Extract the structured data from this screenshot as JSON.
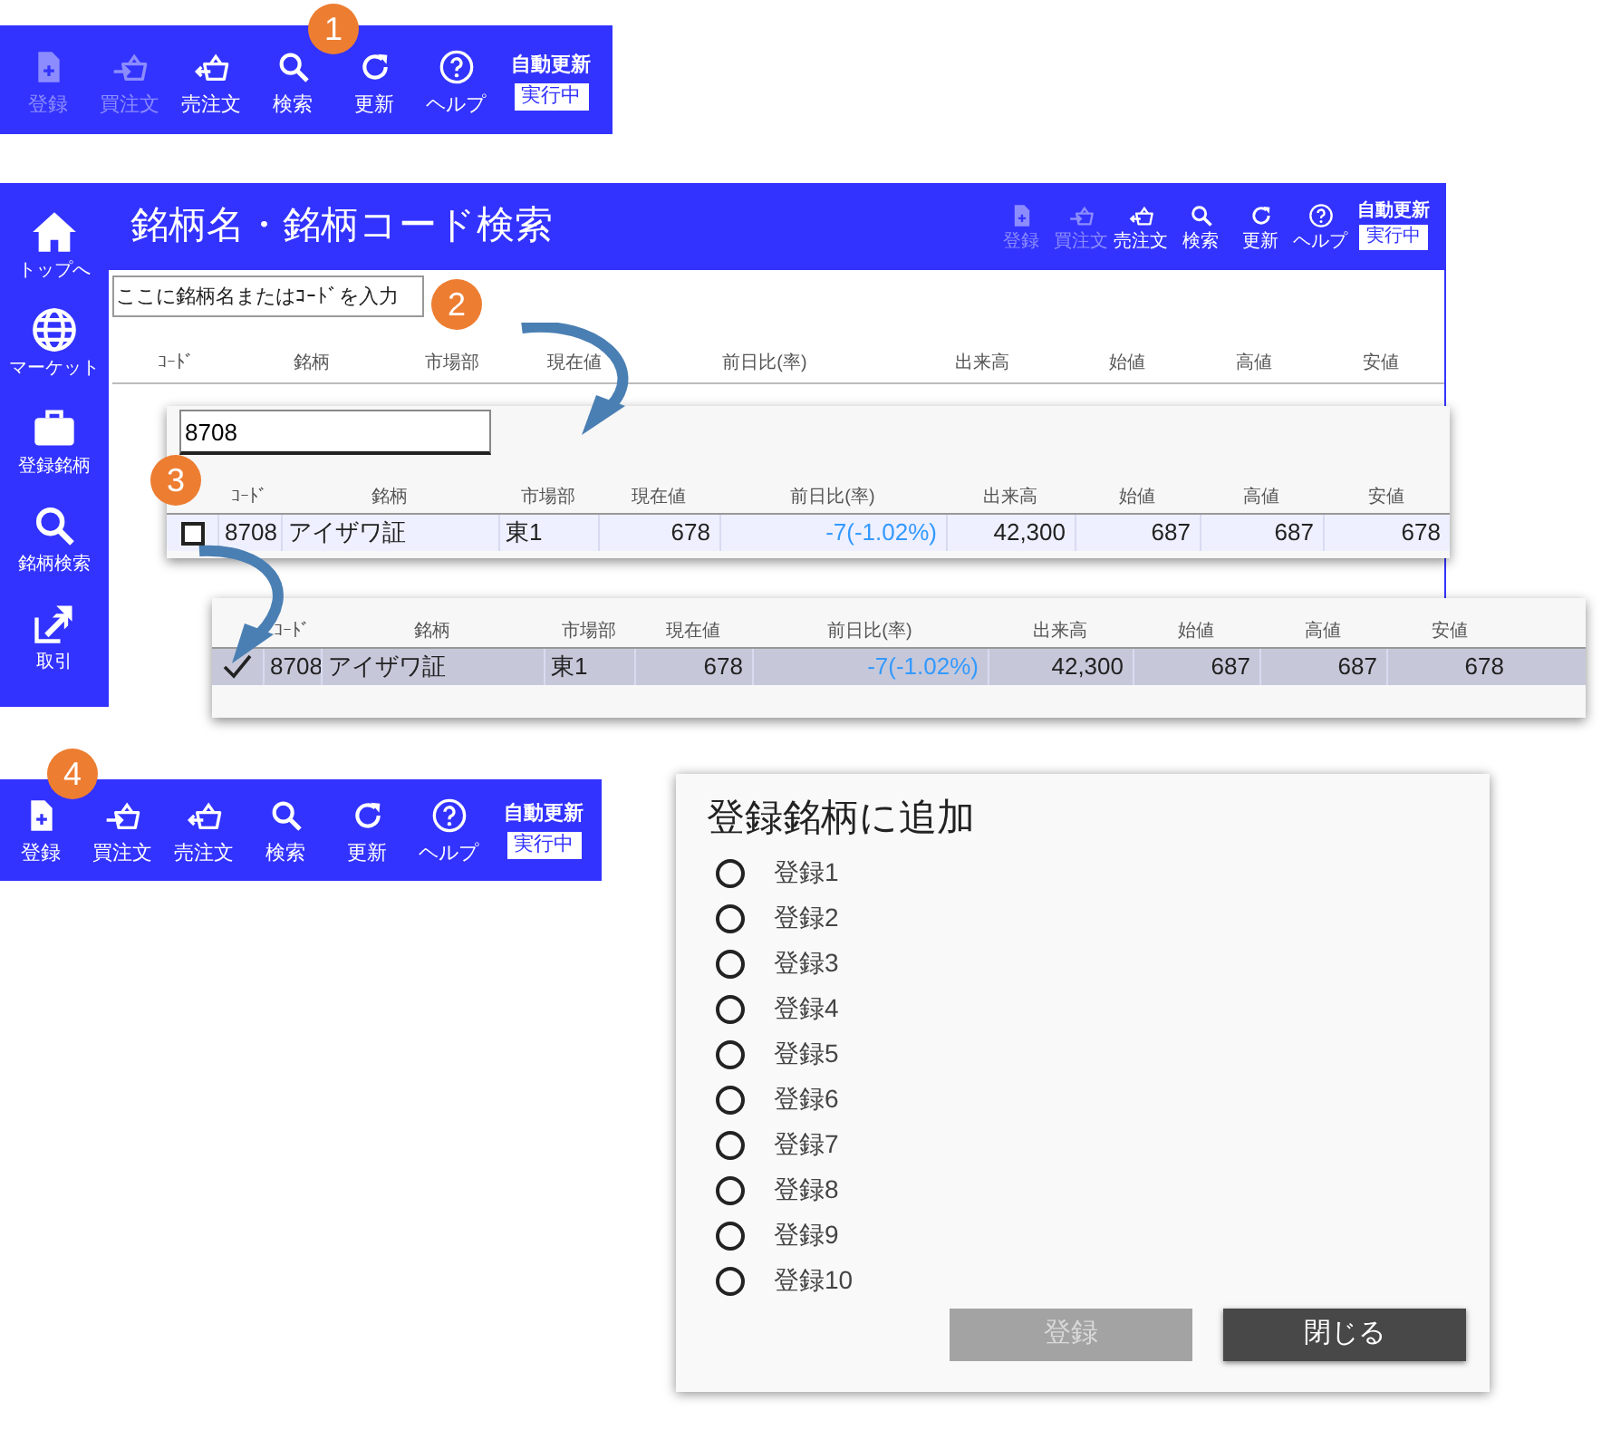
{
  "toolbar_1": {
    "step": "1",
    "buttons": [
      {
        "kind": "register",
        "label": "登録",
        "disabled": true
      },
      {
        "kind": "buy",
        "label": "買注文",
        "disabled": true
      },
      {
        "kind": "sell",
        "label": "売注文",
        "disabled": false
      },
      {
        "kind": "search",
        "label": "検索",
        "disabled": false
      },
      {
        "kind": "refresh",
        "label": "更新",
        "disabled": false
      },
      {
        "kind": "help",
        "label": "ヘルプ",
        "disabled": false
      }
    ],
    "auto_update": {
      "label": "自動更新",
      "status": "実行中"
    }
  },
  "search_window": {
    "title": "銘柄名・銘柄コード検索",
    "step": "2",
    "sidebar": [
      {
        "kind": "home",
        "label": "トップへ"
      },
      {
        "kind": "globe",
        "label": "マーケット"
      },
      {
        "kind": "briefcase",
        "label": "登録銘柄"
      },
      {
        "kind": "search",
        "label": "銘柄検索"
      },
      {
        "kind": "trade",
        "label": "取引"
      }
    ],
    "toolbar": {
      "buttons": [
        {
          "kind": "register",
          "label": "登録",
          "disabled": true
        },
        {
          "kind": "buy",
          "label": "買注文",
          "disabled": true
        },
        {
          "kind": "sell",
          "label": "売注文",
          "disabled": false
        },
        {
          "kind": "search",
          "label": "検索",
          "disabled": false
        },
        {
          "kind": "refresh",
          "label": "更新",
          "disabled": false
        },
        {
          "kind": "help",
          "label": "ヘルプ",
          "disabled": false
        }
      ],
      "auto_update": {
        "label": "自動更新",
        "status": "実行中"
      }
    },
    "search": {
      "placeholder": "ここに銘柄名またはｺｰﾄﾞを入力"
    },
    "columns": [
      "ｺｰﾄﾞ",
      "銘柄",
      "市場部",
      "現在値",
      "前日比(率)",
      "出来高",
      "始値",
      "高値",
      "安値"
    ]
  },
  "result_panel": {
    "step": "3",
    "search": {
      "value": "8708"
    },
    "columns": [
      "ｺｰﾄﾞ",
      "銘柄",
      "市場部",
      "現在値",
      "前日比(率)",
      "出来高",
      "始値",
      "高値",
      "安値"
    ],
    "rows": [
      {
        "checked": false,
        "selected": false,
        "cells": [
          "8708",
          "アイザワ証",
          "東1",
          "678",
          "-7(-1.02%)",
          "42,300",
          "687",
          "687",
          "678"
        ]
      }
    ]
  },
  "selected_panel": {
    "columns": [
      "ｺｰﾄﾞ",
      "銘柄",
      "市場部",
      "現在値",
      "前日比(率)",
      "出来高",
      "始値",
      "高値",
      "安値"
    ],
    "rows": [
      {
        "checked": true,
        "selected": true,
        "cells": [
          "8708",
          "アイザワ証",
          "東1",
          "678",
          "-7(-1.02%)",
          "42,300",
          "687",
          "687",
          "678"
        ]
      }
    ]
  },
  "toolbar_4": {
    "step": "4",
    "buttons": [
      {
        "kind": "register",
        "label": "登録",
        "disabled": false
      },
      {
        "kind": "buy",
        "label": "買注文",
        "disabled": false
      },
      {
        "kind": "sell",
        "label": "売注文",
        "disabled": false
      },
      {
        "kind": "search",
        "label": "検索",
        "disabled": false
      },
      {
        "kind": "refresh",
        "label": "更新",
        "disabled": false
      },
      {
        "kind": "help",
        "label": "ヘルプ",
        "disabled": false
      }
    ],
    "auto_update": {
      "label": "自動更新",
      "status": "実行中"
    }
  },
  "dialog": {
    "title": "登録銘柄に追加",
    "options": [
      {
        "label": "登録1",
        "selected": false
      },
      {
        "label": "登録2",
        "selected": false
      },
      {
        "label": "登録3",
        "selected": false
      },
      {
        "label": "登録4",
        "selected": false
      },
      {
        "label": "登録5",
        "selected": false
      },
      {
        "label": "登録6",
        "selected": false
      },
      {
        "label": "登録7",
        "selected": false
      },
      {
        "label": "登録8",
        "selected": false
      },
      {
        "label": "登録9",
        "selected": false
      },
      {
        "label": "登録10",
        "selected": false
      }
    ],
    "buttons": [
      {
        "label": "登録",
        "disabled": true
      },
      {
        "label": "閉じる",
        "disabled": false
      }
    ]
  }
}
